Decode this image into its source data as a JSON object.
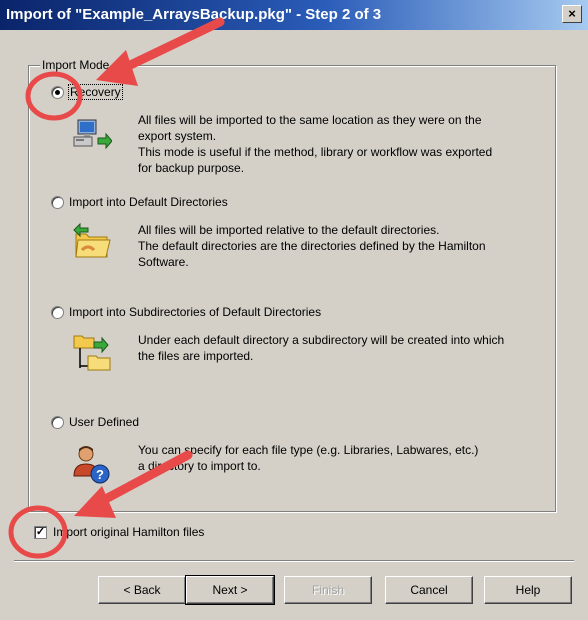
{
  "window": {
    "title": "Import of \"Example_ArraysBackup.pkg\" - Step 2 of 3",
    "close_label": "×"
  },
  "group": {
    "label": "Import Mode"
  },
  "options": [
    {
      "label": "Recovery",
      "selected": true,
      "icon": "computer-import-icon",
      "description": [
        "All files will be imported to the same location as they were on the",
        "export system.",
        "This mode is useful if the method, library or workflow was exported",
        "for backup purpose."
      ]
    },
    {
      "label": "Import into Default Directories",
      "selected": false,
      "icon": "folder-import-icon",
      "description": [
        "All files will be imported relative to the default directories.",
        "The default directories are the directories defined by the Hamilton",
        "Software."
      ]
    },
    {
      "label": "Import into Subdirectories of Default Directories",
      "selected": false,
      "icon": "subfolder-import-icon",
      "description": [
        "Under each default directory a subdirectory will be created into which",
        "the files are imported."
      ]
    },
    {
      "label": "User Defined",
      "selected": false,
      "icon": "user-question-icon",
      "description": [
        "You can specify for each file type (e.g. Libraries, Labwares, etc.)",
        "a directory to import to."
      ]
    }
  ],
  "checkbox": {
    "label": "Import original Hamilton files",
    "checked": true
  },
  "buttons": {
    "back": "< Back",
    "next": "Next >",
    "finish": "Finish",
    "cancel": "Cancel",
    "help": "Help"
  },
  "colors": {
    "annotation_red": "#e84a4a",
    "titlebar": "#0a246a"
  }
}
